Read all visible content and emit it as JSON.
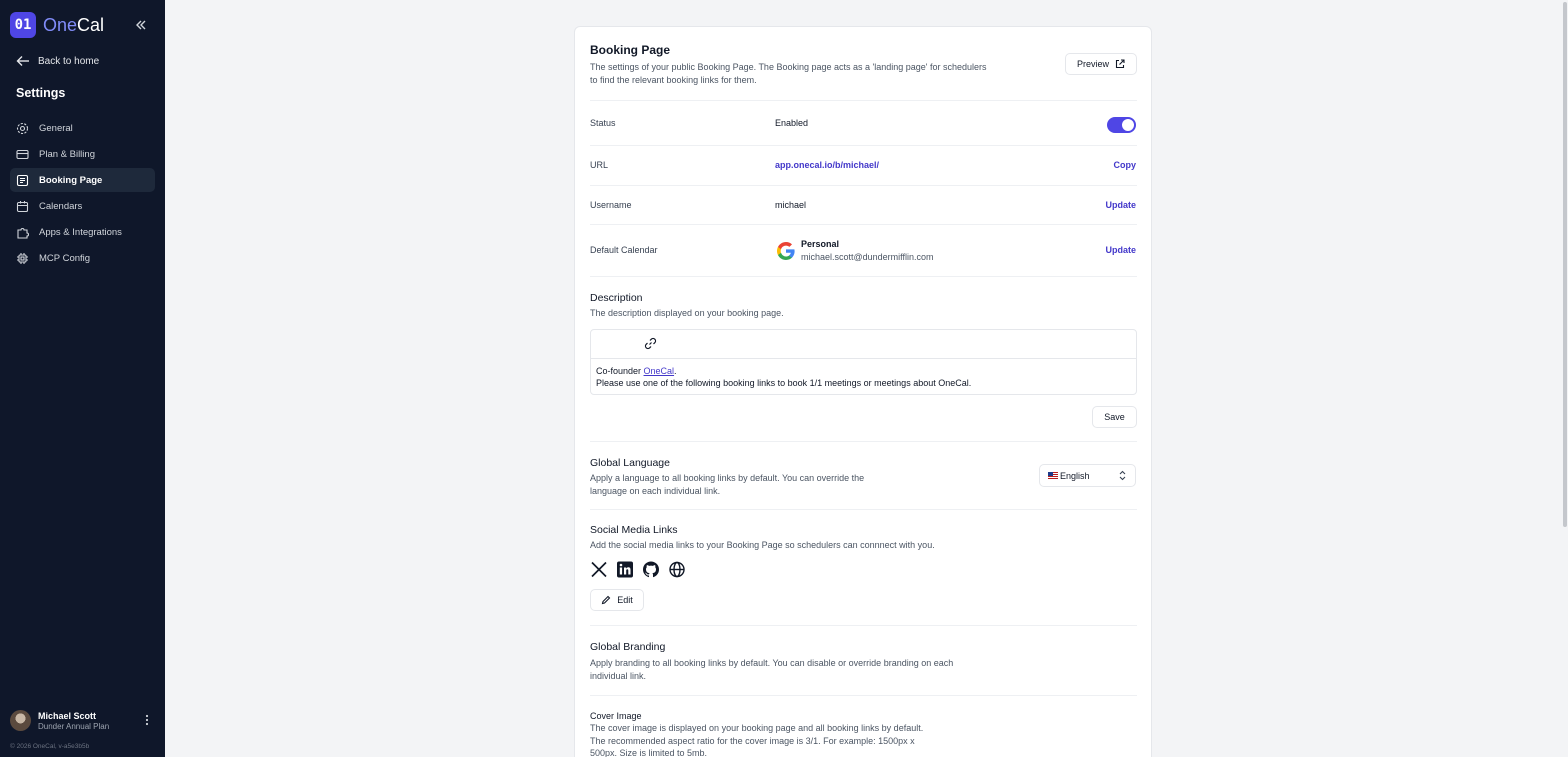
{
  "app": {
    "logo_mark": "01",
    "logo_one": "One",
    "logo_cal": "Cal"
  },
  "sidebar": {
    "back_label": "Back to home",
    "title": "Settings",
    "items": [
      {
        "label": "General",
        "icon": "gear-icon"
      },
      {
        "label": "Plan & Billing",
        "icon": "credit-card-icon"
      },
      {
        "label": "Booking Page",
        "icon": "booking-page-icon",
        "active": true
      },
      {
        "label": "Calendars",
        "icon": "calendar-icon"
      },
      {
        "label": "Apps & Integrations",
        "icon": "puzzle-icon"
      },
      {
        "label": "MCP Config",
        "icon": "chip-icon"
      }
    ],
    "user": {
      "name": "Michael Scott",
      "plan": "Dunder Annual Plan"
    },
    "version": "© 2026 OneCal, v-a5e3b5b"
  },
  "booking": {
    "title": "Booking Page",
    "subtitle_1": "The settings of your public Booking Page. The Booking page acts as a 'landing page' for schedulers",
    "subtitle_2": "to find the relevant booking links for them.",
    "preview_label": "Preview",
    "status_label": "Status",
    "status_value": "Enabled",
    "url_label": "URL",
    "url_value": "app.onecal.io/b/michael/",
    "copy_label": "Copy",
    "username_label": "Username",
    "username_value": "michael",
    "update_label": "Update",
    "default_calendar_label": "Default Calendar",
    "calendar_name": "Personal",
    "calendar_email": "michael.scott@dundermifflin.com"
  },
  "description": {
    "title": "Description",
    "subtitle": "The description displayed on your booking page.",
    "line1_prefix": "Co-founder ",
    "line1_link": "OneCal",
    "line1_suffix": ".",
    "line2": "Please use one of the following booking links to book 1/1 meetings or meetings about OneCal.",
    "save_label": "Save"
  },
  "language": {
    "title": "Global Language",
    "subtitle_1": "Apply a language to all booking links by default. You can override the",
    "subtitle_2": "language on each individual link.",
    "selected": "English"
  },
  "social": {
    "title": "Social Media Links",
    "subtitle": "Add the social media links to your Booking Page so schedulers can connnect with you.",
    "icons": [
      "x-icon",
      "linkedin-icon",
      "github-icon",
      "globe-icon"
    ],
    "edit_label": "Edit"
  },
  "branding": {
    "title": "Global Branding",
    "subtitle_1": "Apply branding to all booking links by default. You can disable or override branding on each",
    "subtitle_2": "individual link."
  },
  "cover": {
    "title": "Cover Image",
    "line1": "The cover image is displayed on your booking page and all booking links by default.",
    "line2": "The recommended aspect ratio for the cover image is 3/1. For example: 1500px x",
    "line3": "500px. Size is limited to 5mb."
  },
  "colors": {
    "sidebar_bg": "#0f172a",
    "accent": "#4f46e5",
    "link": "#4338ca"
  }
}
